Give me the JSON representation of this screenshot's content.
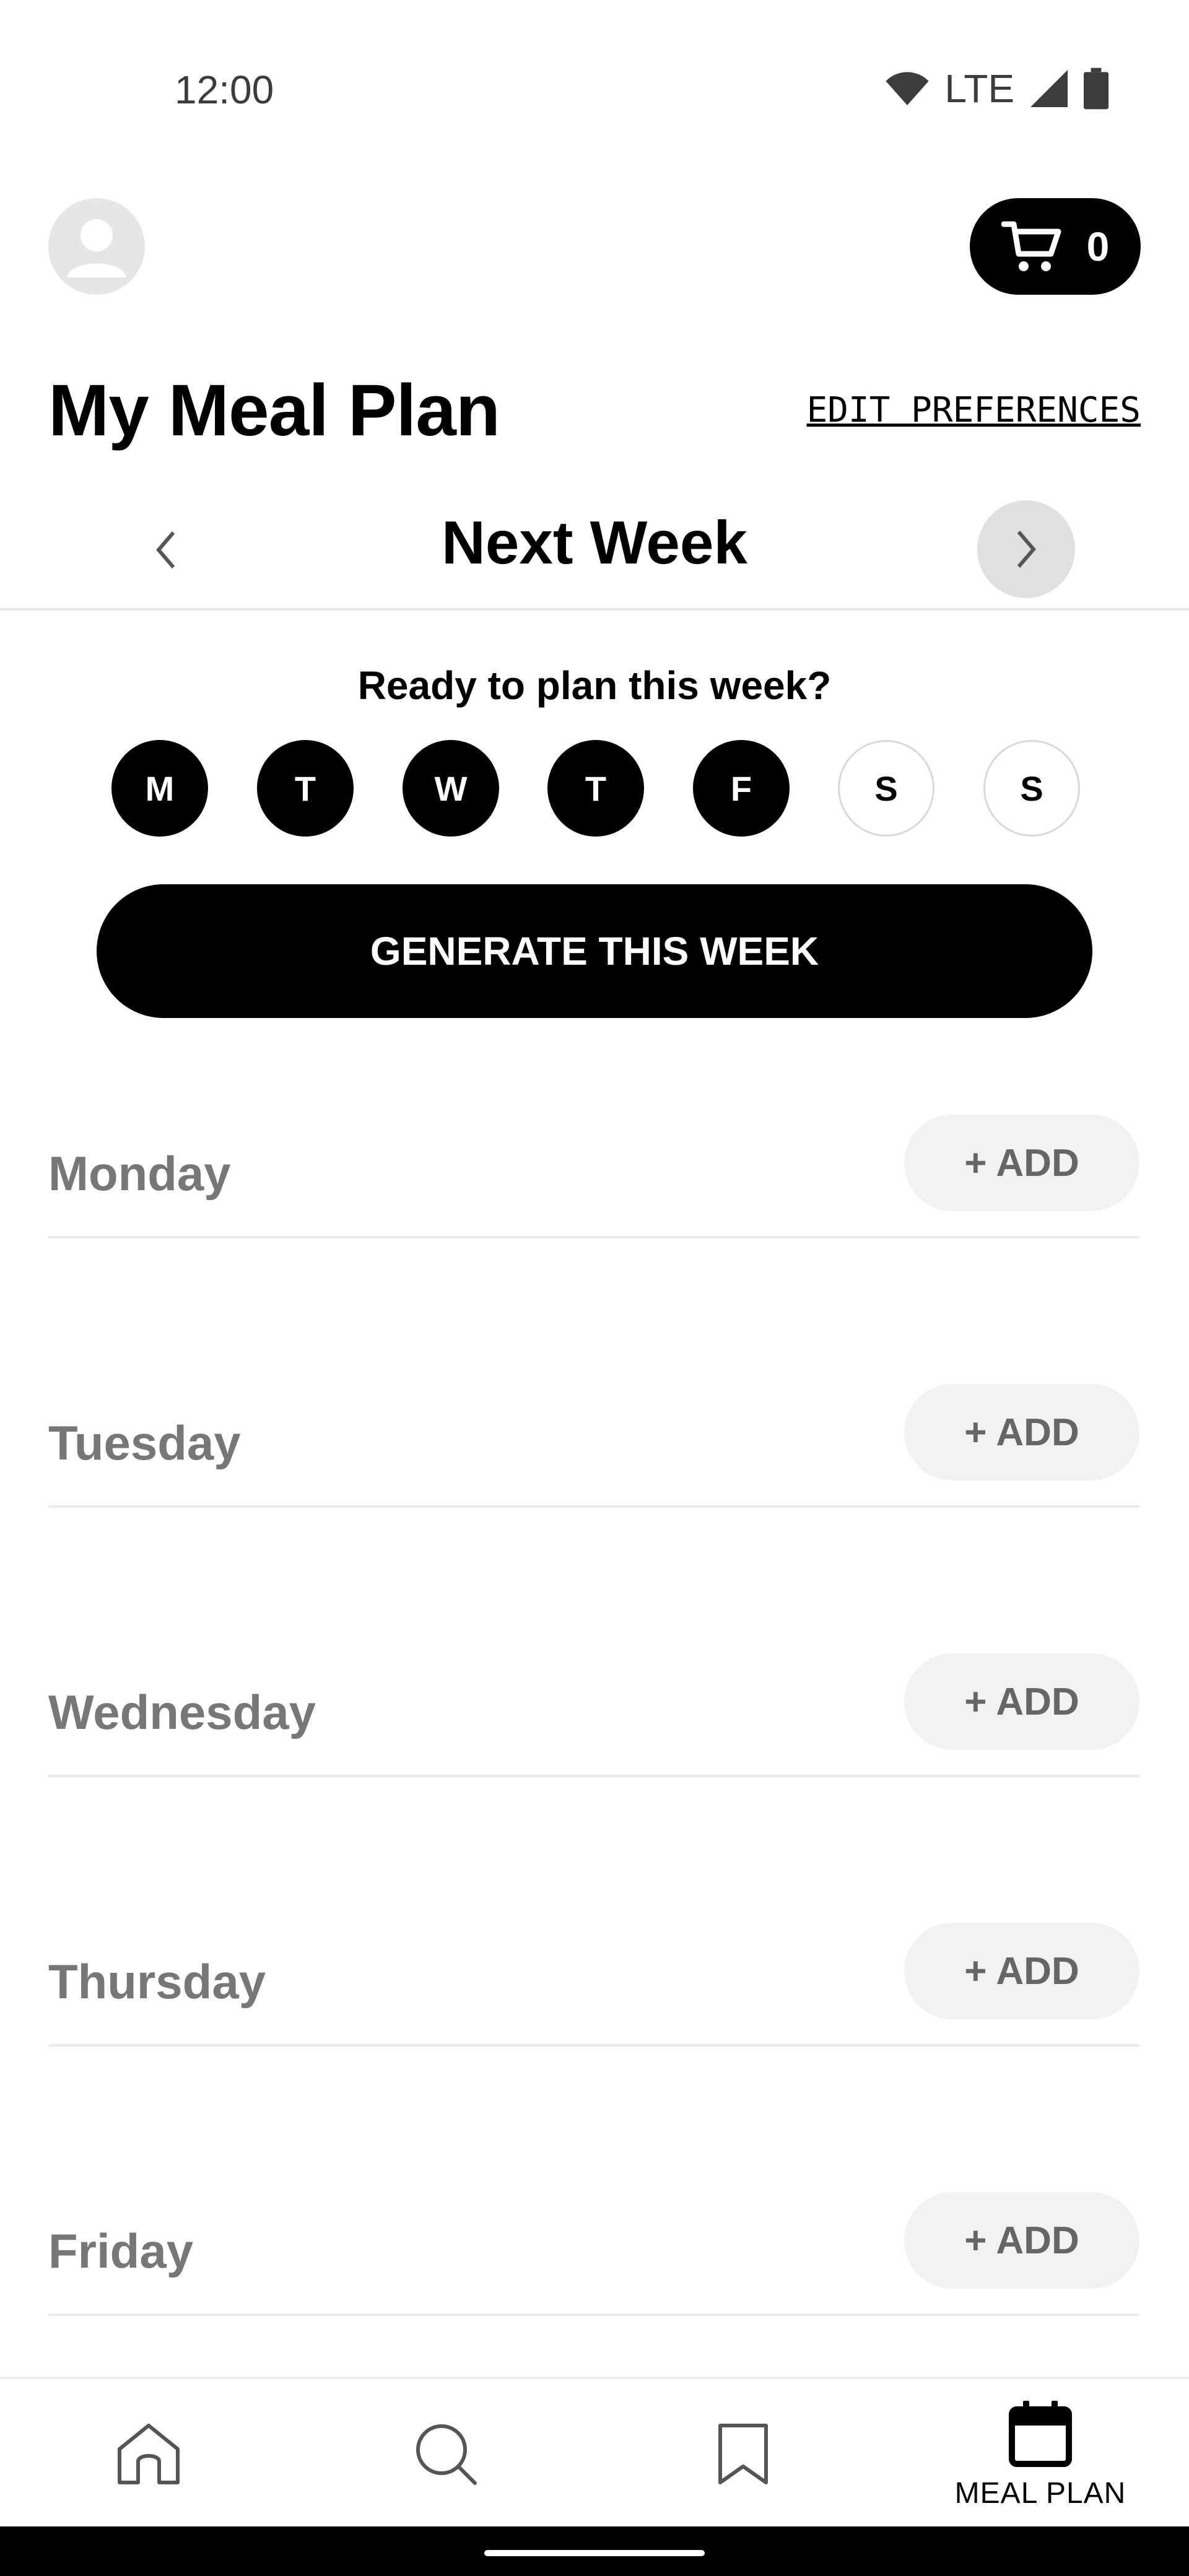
{
  "status_bar": {
    "time": "12:00",
    "network": "LTE"
  },
  "header": {
    "cart_count": "0"
  },
  "title": "My Meal Plan",
  "edit_preferences": "EDIT PREFERENCES",
  "week": {
    "label": "Next Week"
  },
  "plan_prompt": "Ready to plan this week?",
  "day_selector": [
    {
      "letter": "M",
      "selected": true
    },
    {
      "letter": "T",
      "selected": true
    },
    {
      "letter": "W",
      "selected": true
    },
    {
      "letter": "T",
      "selected": true
    },
    {
      "letter": "F",
      "selected": true
    },
    {
      "letter": "S",
      "selected": false
    },
    {
      "letter": "S",
      "selected": false
    }
  ],
  "generate_button": "GENERATE THIS WEEK",
  "days": [
    {
      "name": "Monday",
      "add_label": "+ ADD"
    },
    {
      "name": "Tuesday",
      "add_label": "+ ADD"
    },
    {
      "name": "Wednesday",
      "add_label": "+ ADD"
    },
    {
      "name": "Thursday",
      "add_label": "+ ADD"
    },
    {
      "name": "Friday",
      "add_label": "+ ADD"
    }
  ],
  "bottom_nav": {
    "items": [
      {
        "icon": "home-icon",
        "label": ""
      },
      {
        "icon": "search-icon",
        "label": ""
      },
      {
        "icon": "bookmark-icon",
        "label": ""
      },
      {
        "icon": "calendar-icon",
        "label": "MEAL PLAN",
        "active": true
      }
    ]
  },
  "colors": {
    "accent": "#000000",
    "muted_text": "#777777",
    "pill_bg": "#f2f2f2"
  }
}
